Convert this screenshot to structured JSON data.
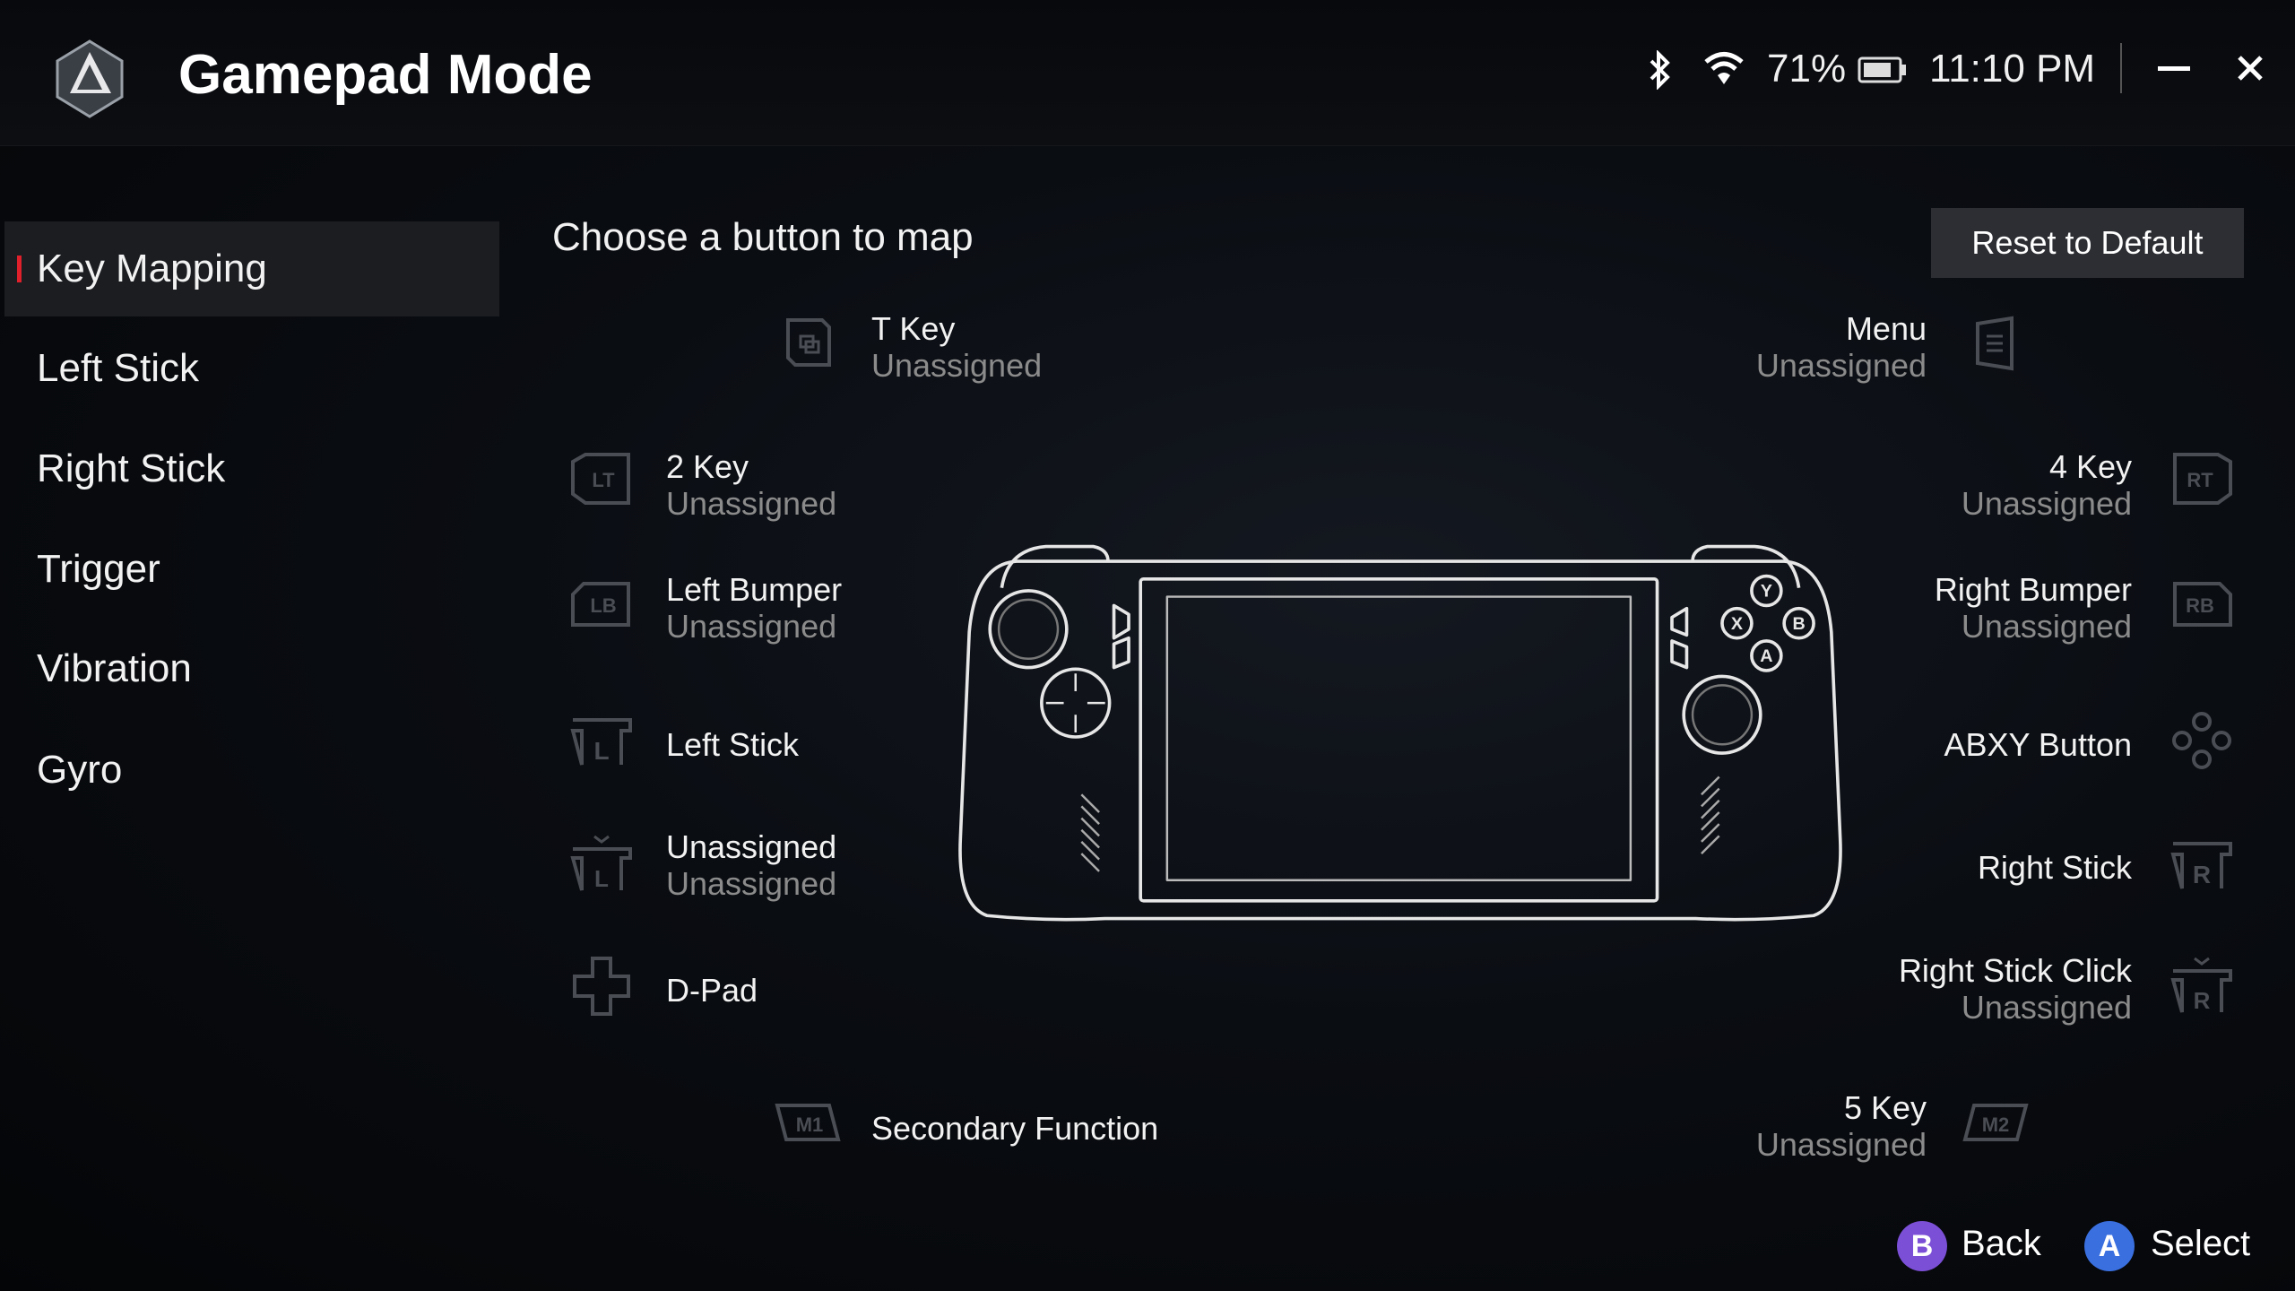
{
  "header": {
    "title": "Gamepad Mode",
    "logo_icon": "rog-ally-logo",
    "battery_percent": "71%",
    "time": "11:10 PM",
    "icons": [
      "bluetooth-icon",
      "wifi-icon",
      "battery-icon",
      "minimize-icon",
      "close-icon"
    ]
  },
  "sidebar": {
    "items": [
      {
        "label": "Key Mapping",
        "active": true
      },
      {
        "label": "Left Stick"
      },
      {
        "label": "Right Stick"
      },
      {
        "label": "Trigger"
      },
      {
        "label": "Vibration"
      },
      {
        "label": "Gyro"
      }
    ],
    "accent": "#e0202a"
  },
  "main": {
    "heading": "Choose a button to map",
    "reset_label": "Reset to Default",
    "mappings": {
      "t_key": {
        "title": "T Key",
        "sub": "Unassigned"
      },
      "menu": {
        "title": "Menu",
        "sub": "Unassigned"
      },
      "key2": {
        "title": "2 Key",
        "sub": "Unassigned",
        "icon": "LT"
      },
      "key4": {
        "title": "4 Key",
        "sub": "Unassigned",
        "icon": "RT"
      },
      "left_bumper": {
        "title": "Left Bumper",
        "sub": "Unassigned",
        "icon": "LB"
      },
      "right_bumper": {
        "title": "Right Bumper",
        "sub": "Unassigned",
        "icon": "RB"
      },
      "left_stick": {
        "title": "Left Stick",
        "icon": "L"
      },
      "abxy": {
        "title": "ABXY Button"
      },
      "left_stick_click": {
        "title": "Unassigned",
        "sub": "Unassigned",
        "icon": "L"
      },
      "right_stick": {
        "title": "Right Stick",
        "icon": "R"
      },
      "dpad": {
        "title": "D-Pad"
      },
      "right_stick_click": {
        "title": "Right Stick Click",
        "sub": "Unassigned",
        "icon": "R"
      },
      "secondary": {
        "title": "Secondary Function",
        "icon": "M1"
      },
      "key5": {
        "title": "5 Key",
        "sub": "Unassigned",
        "icon": "M2"
      }
    }
  },
  "footer": {
    "back": {
      "glyph": "B",
      "label": "Back",
      "color": "#7b4fd6"
    },
    "select": {
      "glyph": "A",
      "label": "Select",
      "color": "#3a6fe0"
    }
  }
}
